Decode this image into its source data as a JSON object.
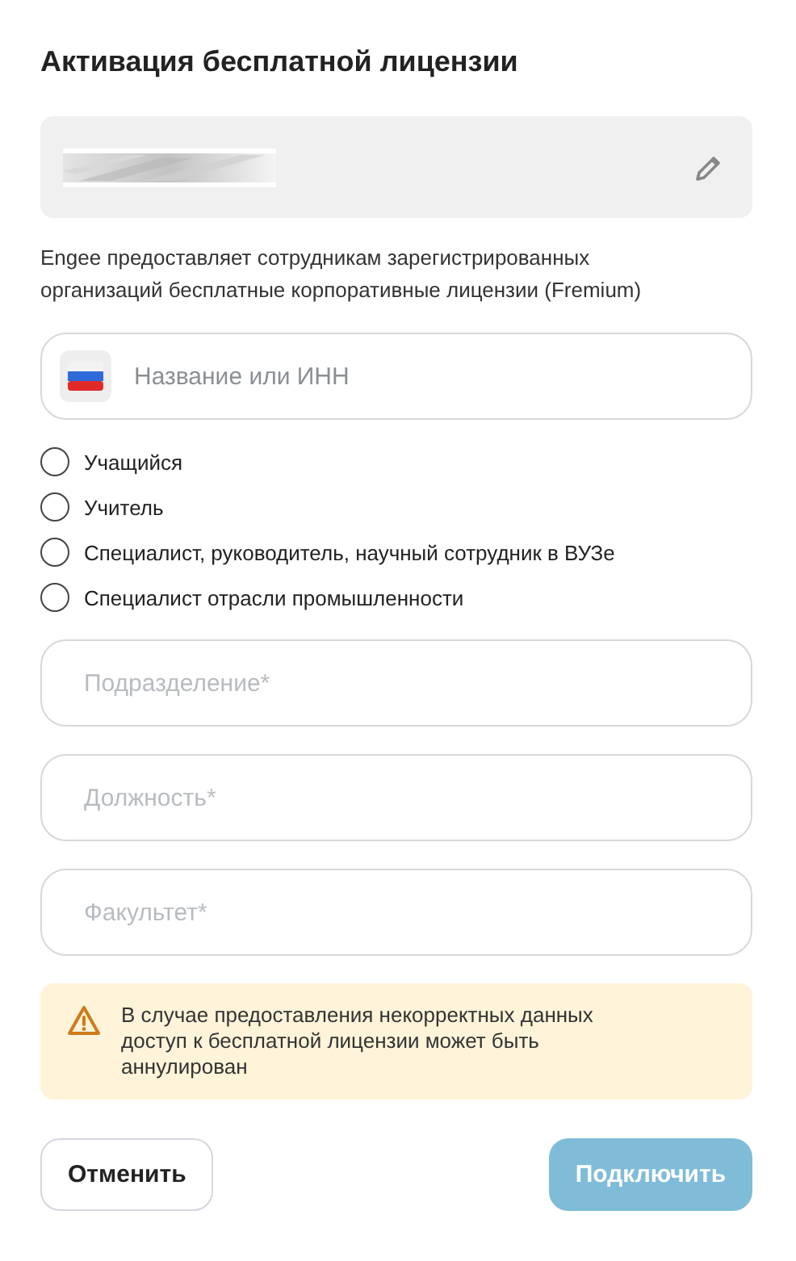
{
  "title": "Активация бесплатной лицензии",
  "account": {
    "kind": "redacted"
  },
  "description": "Engee предоставляет сотрудникам зарегистрированных организаций бесплатные корпоративные лицензии (Fremium)",
  "organization": {
    "placeholder": "Название или ИНН"
  },
  "roles": [
    {
      "label": "Учащийся",
      "selected": false
    },
    {
      "label": "Учитель",
      "selected": false
    },
    {
      "label": "Специалист, руководитель, научный сотрудник в ВУЗе",
      "selected": false
    },
    {
      "label": "Специалист отрасли промышленности",
      "selected": false
    }
  ],
  "fields": [
    {
      "placeholder": "Подразделение*"
    },
    {
      "placeholder": "Должность*"
    },
    {
      "placeholder": "Факультет*"
    }
  ],
  "warning": "В случае предоставления некорректных данных доступ к бесплатной лицензии может быть аннулирован",
  "buttons": [
    {
      "label": "Отменить",
      "kind": "secondary",
      "disabled": false
    },
    {
      "label": "Подключить",
      "kind": "primary",
      "disabled": true
    }
  ]
}
